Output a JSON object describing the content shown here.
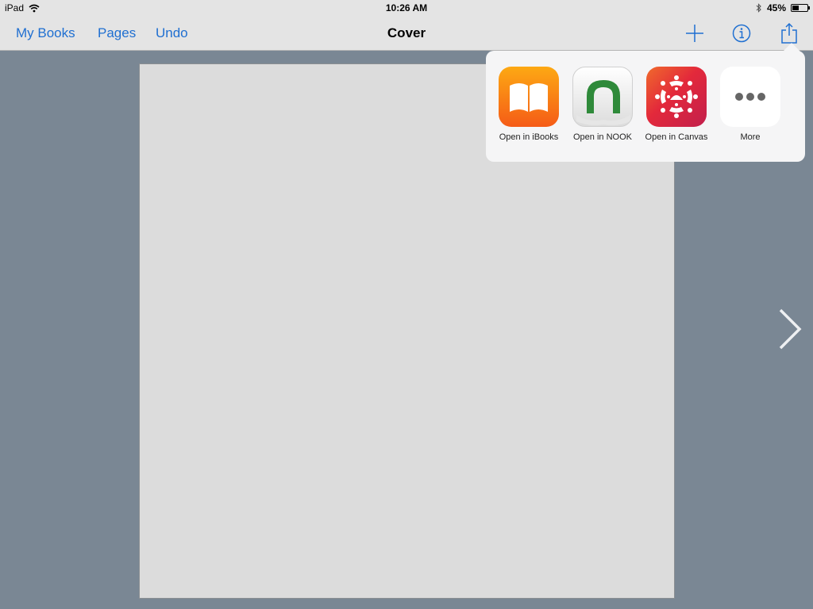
{
  "status_bar": {
    "device": "iPad",
    "time": "10:26 AM",
    "battery_percent": "45%",
    "battery_level": 0.45,
    "icons": [
      "wifi-icon",
      "bluetooth-icon",
      "battery-icon"
    ]
  },
  "nav": {
    "my_books": "My Books",
    "pages": "Pages",
    "undo": "Undo",
    "title": "Cover",
    "icons": [
      "plus-icon",
      "info-icon",
      "share-icon"
    ]
  },
  "share_sheet": {
    "items": [
      {
        "label": "Open in iBooks",
        "icon": "ibooks-icon"
      },
      {
        "label": "Open in NOOK",
        "icon": "nook-icon"
      },
      {
        "label": "Open in Canvas",
        "icon": "canvas-icon"
      },
      {
        "label": "More",
        "icon": "more-icon"
      }
    ]
  },
  "colors": {
    "accent": "#1f6fd1",
    "background": "#7a8794",
    "page": "#dcdcdc"
  }
}
